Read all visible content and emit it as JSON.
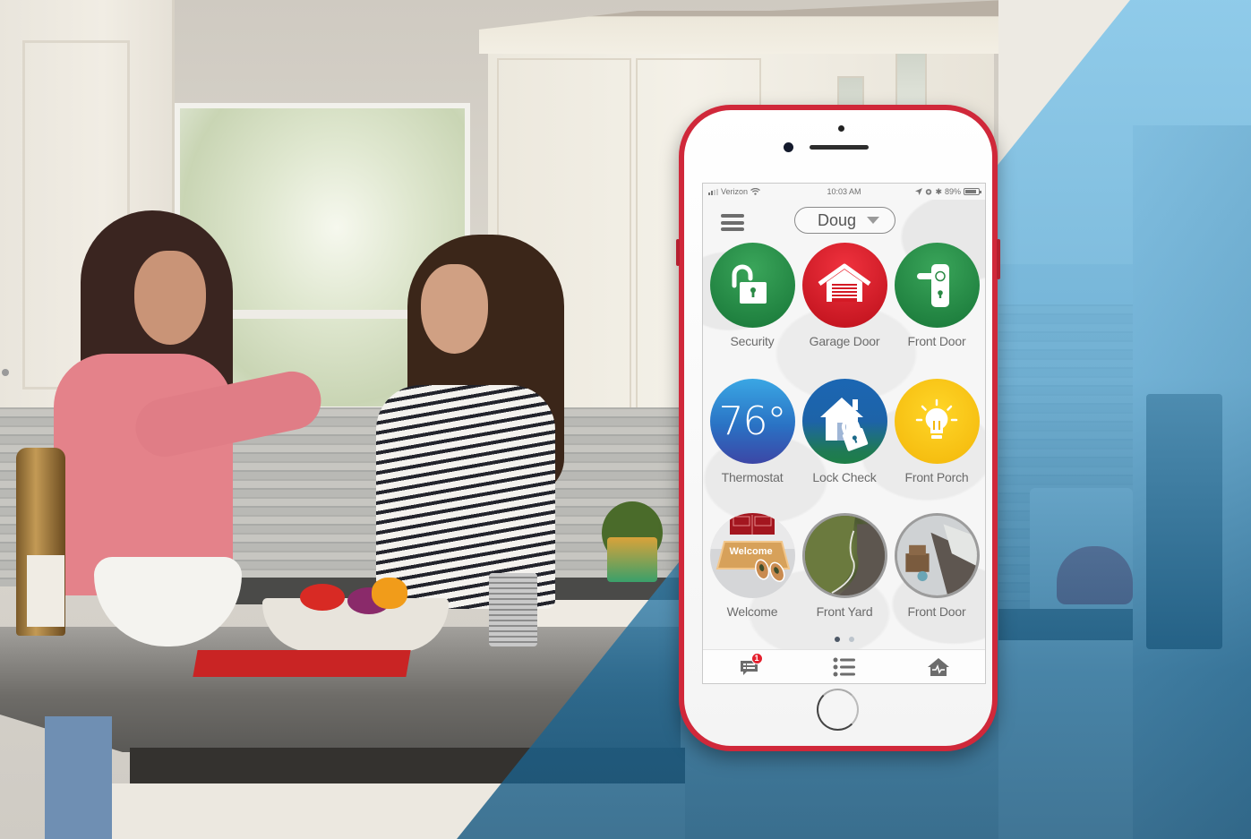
{
  "scene": {
    "description": "Kitchen photo background with two women toasting wine glasses; blue diagonal overlay on right",
    "overlay_color": "#5aaad7"
  },
  "phone": {
    "frame_color": "#d0283a",
    "status_bar": {
      "carrier": "Verizon",
      "time": "10:03 AM",
      "battery": "89%",
      "battery_level": 0.89,
      "icons": [
        "signal-icon",
        "wifi-icon",
        "location-icon",
        "alarm-icon",
        "bluetooth-icon",
        "battery-icon"
      ]
    },
    "header": {
      "menu_icon": "hamburger-menu-icon",
      "user_selector": {
        "value": "Doug",
        "icon": "caret-down-icon"
      }
    },
    "tiles": [
      {
        "label": "Security",
        "icon": "unlocked-padlock-icon",
        "color": "#2a9249",
        "state": "unlocked"
      },
      {
        "label": "Garage Door",
        "icon": "garage-icon",
        "color": "#e41e2b",
        "state": "open"
      },
      {
        "label": "Front Door",
        "icon": "door-handle-icon",
        "color": "#2a9249",
        "state": "unlocked"
      },
      {
        "label": "Thermostat",
        "icon": "thermostat-icon",
        "value": "76°",
        "color": "#2f86d2"
      },
      {
        "label": "Lock Check",
        "icon": "house-lock-icon",
        "color": "#1b66b3"
      },
      {
        "label": "Front Porch",
        "icon": "light-bulb-icon",
        "color": "#f7c415",
        "state": "on"
      },
      {
        "label": "Welcome",
        "icon": "welcome-mat-icon",
        "mat_text": "Welcome"
      },
      {
        "label": "Front Yard",
        "icon": "camera-thumbnail"
      },
      {
        "label": "Front Door",
        "icon": "camera-thumbnail"
      }
    ],
    "pager": {
      "pages": 2,
      "active": 1
    },
    "tabbar": [
      {
        "name": "messages",
        "icon": "message-icon",
        "badge": "1"
      },
      {
        "name": "list",
        "icon": "list-icon"
      },
      {
        "name": "home-activity",
        "icon": "home-pulse-icon"
      }
    ]
  }
}
